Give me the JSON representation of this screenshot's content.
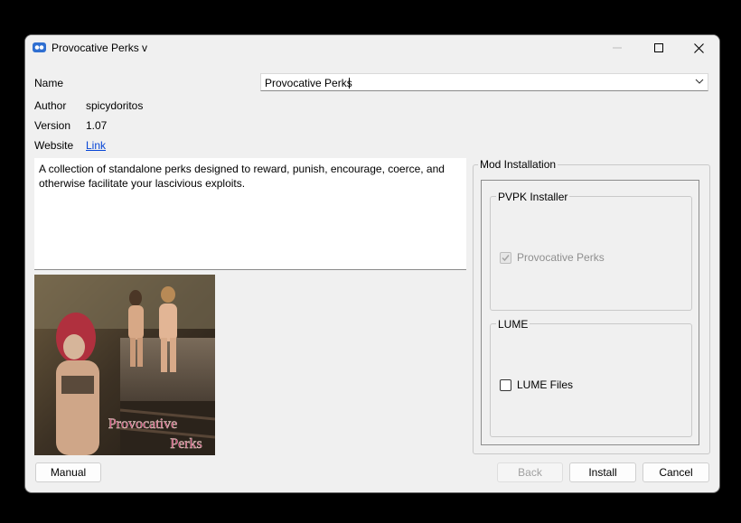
{
  "window": {
    "title": "Provocative Perks v"
  },
  "info": {
    "name_label": "Name",
    "name_value": "Provocative Perks",
    "author_label": "Author",
    "author_value": "spicydoritos",
    "version_label": "Version",
    "version_value": "1.07",
    "website_label": "Website",
    "website_link": "Link"
  },
  "description": "A collection of standalone perks designed to reward, punish, encourage, coerce, and otherwise facilitate your lascivious exploits.",
  "image": {
    "overlay_line1": "Provocative",
    "overlay_line2": "Perks"
  },
  "installation": {
    "title": "Mod Installation",
    "groups": [
      {
        "title": "PVPK Installer",
        "option_label": "Provocative Perks",
        "checked": true,
        "disabled": true
      },
      {
        "title": "LUME",
        "option_label": "LUME Files",
        "checked": false,
        "disabled": false
      }
    ]
  },
  "buttons": {
    "manual": "Manual",
    "back": "Back",
    "install": "Install",
    "cancel": "Cancel"
  },
  "colors": {
    "link": "#0645d6",
    "accent": "#0b5cc4"
  }
}
